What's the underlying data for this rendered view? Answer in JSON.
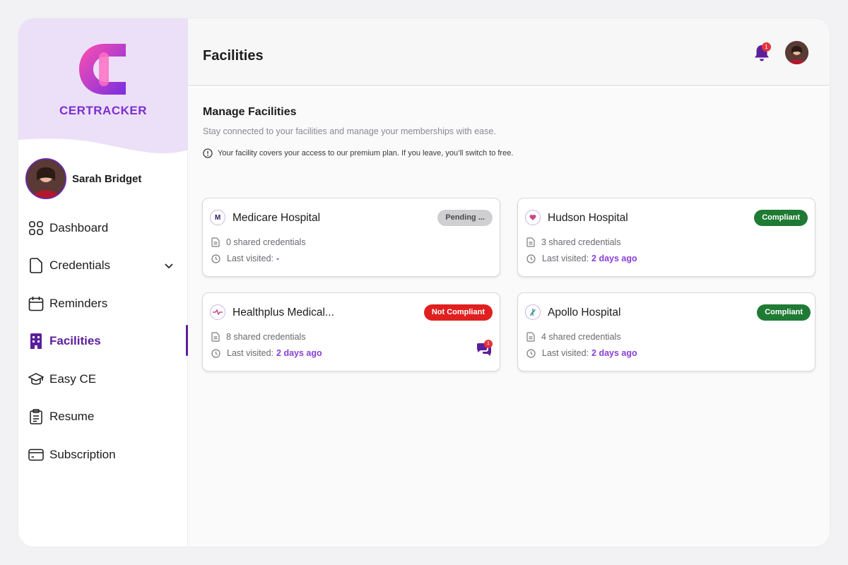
{
  "app": {
    "brand_name": "CERTRACKER",
    "accent_color": "#5b1f9a",
    "link_color": "#8a3fd6"
  },
  "user": {
    "name": "Sarah Bridget"
  },
  "nav": {
    "items": [
      {
        "label": "Dashboard",
        "icon": "dashboard-grid-icon"
      },
      {
        "label": "Credentials",
        "icon": "document-icon",
        "has_chevron": true
      },
      {
        "label": "Reminders",
        "icon": "calendar-icon"
      },
      {
        "label": "Facilities",
        "icon": "building-icon",
        "active": true
      },
      {
        "label": "Easy CE",
        "icon": "graduation-cap-icon"
      },
      {
        "label": "Resume",
        "icon": "clipboard-icon"
      },
      {
        "label": "Subscription",
        "icon": "credit-card-icon"
      }
    ]
  },
  "header": {
    "title": "Facilities",
    "notification_count": "1"
  },
  "main": {
    "title": "Manage Facilities",
    "subtitle": "Stay connected to your facilities and manage your memberships with ease.",
    "notice": "Your facility covers your access to our premium plan. If you leave, you’ll switch to free.",
    "last_visited_label": "Last visited:",
    "facilities": [
      {
        "name": "Medicare Hospital",
        "status": "Pending ...",
        "status_type": "pending",
        "credentials": "0 shared credentials",
        "last_visited": "-"
      },
      {
        "name": "Hudson Hospital",
        "status": "Compliant",
        "status_type": "compliant",
        "credentials": "3 shared credentials",
        "last_visited": "2 days ago"
      },
      {
        "name": "Healthplus Medical...",
        "status": "Not Compliant",
        "status_type": "noncompliant",
        "credentials": "8 shared credentials",
        "last_visited": "2 days ago",
        "message_count": "1"
      },
      {
        "name": "Apollo Hospital",
        "status": "Compliant",
        "status_type": "compliant",
        "credentials": "4 shared credentials",
        "last_visited": "2 days ago"
      }
    ]
  }
}
